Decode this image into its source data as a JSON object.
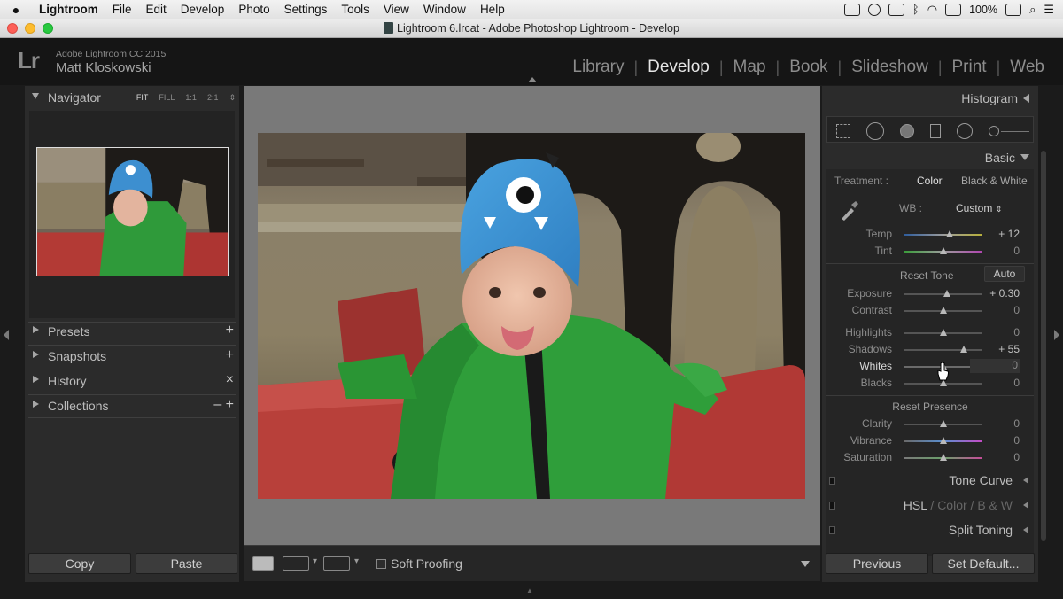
{
  "menubar": {
    "items": [
      "Lightroom",
      "File",
      "Edit",
      "Develop",
      "Photo",
      "Settings",
      "Tools",
      "View",
      "Window",
      "Help"
    ],
    "battery": "100%"
  },
  "window": {
    "title": "Lightroom 6.lrcat - Adobe Photoshop Lightroom - Develop"
  },
  "identity": {
    "logo": "Lr",
    "app_name": "Adobe Lightroom CC 2015",
    "user_name": "Matt Kloskowski"
  },
  "modules": [
    "Library",
    "Develop",
    "Map",
    "Book",
    "Slideshow",
    "Print",
    "Web"
  ],
  "active_module": "Develop",
  "left_panel": {
    "navigator": {
      "label": "Navigator",
      "zoom_options": [
        "FIT",
        "FILL",
        "1:1",
        "2:1"
      ],
      "active_zoom": "FIT"
    },
    "sections": [
      {
        "label": "Presets",
        "action": "+"
      },
      {
        "label": "Snapshots",
        "action": "+"
      },
      {
        "label": "History",
        "action": "×"
      },
      {
        "label": "Collections",
        "action": "– +"
      }
    ],
    "copy_label": "Copy",
    "paste_label": "Paste"
  },
  "toolbar": {
    "soft_proofing_label": "Soft Proofing",
    "soft_proofing_checked": false
  },
  "right_panel": {
    "histogram_label": "Histogram",
    "basic_label": "Basic",
    "treatment": {
      "label": "Treatment :",
      "options": [
        "Color",
        "Black & White"
      ],
      "selected": "Color"
    },
    "wb": {
      "label": "WB :",
      "value": "Custom"
    },
    "reset_tone_label": "Reset Tone",
    "auto_label": "Auto",
    "reset_presence_label": "Reset Presence",
    "sliders": [
      {
        "name": "Temp",
        "value": "+ 12",
        "pos": 0.58
      },
      {
        "name": "Tint",
        "value": "0",
        "pos": 0.5
      },
      {
        "name": "Exposure",
        "value": "+ 0.30",
        "pos": 0.55
      },
      {
        "name": "Contrast",
        "value": "0",
        "pos": 0.5
      },
      {
        "name": "Highlights",
        "value": "0",
        "pos": 0.5
      },
      {
        "name": "Shadows",
        "value": "+ 55",
        "pos": 0.76
      },
      {
        "name": "Whites",
        "value": "0",
        "pos": 0.5
      },
      {
        "name": "Blacks",
        "value": "0",
        "pos": 0.5
      },
      {
        "name": "Clarity",
        "value": "0",
        "pos": 0.5
      },
      {
        "name": "Vibrance",
        "value": "0",
        "pos": 0.5
      },
      {
        "name": "Saturation",
        "value": "0",
        "pos": 0.5
      }
    ],
    "collapsed": {
      "tone_curve": "Tone Curve",
      "hsl": [
        "HSL",
        "Color",
        "B & W"
      ],
      "split_toning": "Split Toning"
    },
    "previous_label": "Previous",
    "set_default_label": "Set Default..."
  },
  "colors": {
    "panel_bg": "#2b2b2b",
    "center_bg": "#797979",
    "accent_text": "#e6e6e6"
  }
}
